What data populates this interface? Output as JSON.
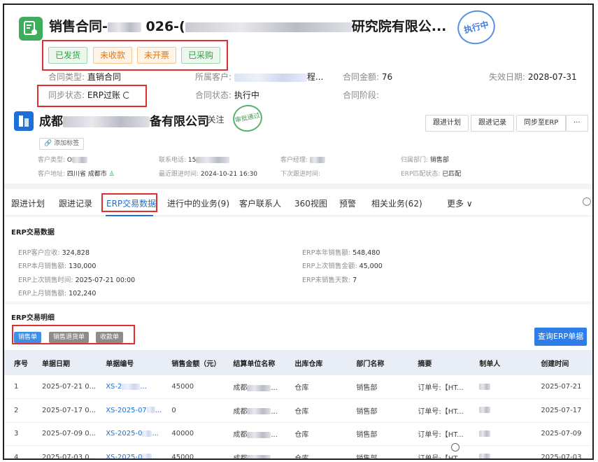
{
  "header": {
    "title_prefix": "销售合同-",
    "title_mid": "026-(",
    "title_suffix": "研究院有限公...",
    "stamp_text": "执行中",
    "tags": [
      "已发货",
      "未收款",
      "未开票",
      "已采购"
    ],
    "fields": {
      "contract_type_label": "合同类型:",
      "contract_type_value": "直销合同",
      "customer_label": "所属客户:",
      "customer_value": "程...",
      "amount_label": "合同金额:",
      "amount_value": "76",
      "expire_label": "失效日期:",
      "expire_value": "2028-07-31",
      "sync_label": "同步状态:",
      "sync_value": "ERP过账",
      "status_label": "合同状态:",
      "status_value": "执行中",
      "stage_label": "合同阶段:",
      "stage_value": ""
    }
  },
  "customer": {
    "name_prefix": "成都",
    "name_suffix": "备有限公司",
    "follow_label": "关注",
    "seal_text": "审批通过",
    "buttons": [
      "跟进计划",
      "跟进记录",
      "同步至ERP",
      "···"
    ],
    "add_tag": "添加标签",
    "info": {
      "type_label": "客户类型:",
      "type_value": "O",
      "phone_label": "联系电话:",
      "phone_value": "15",
      "manager_label": "客户经理:",
      "manager_value": "",
      "dept_label": "归属部门:",
      "dept_value": "销售部",
      "address_label": "客户地址:",
      "address_value": "四川省 成都市",
      "last_follow_label": "最近跟进时间:",
      "last_follow_value": "2024-10-21 16:30",
      "next_follow_label": "下次跟进时间:",
      "next_follow_value": "",
      "erp_match_label": "ERP匹配状态:",
      "erp_match_value": "已匹配"
    }
  },
  "tabs": [
    {
      "label": "跟进计划"
    },
    {
      "label": "跟进记录"
    },
    {
      "label": "ERP交易数据"
    },
    {
      "label": "进行中的业务(9)"
    },
    {
      "label": "客户联系人"
    },
    {
      "label": "360视图"
    },
    {
      "label": "预警"
    },
    {
      "label": "相关业务(62)"
    },
    {
      "label": "更多"
    }
  ],
  "erp_data": {
    "title": "ERP交易数据",
    "receivable_label": "ERP客户应收:",
    "receivable_value": "324,828",
    "year_sales_label": "ERP本年销售额:",
    "year_sales_value": "548,480",
    "month_sales_label": "ERP本月销售额:",
    "month_sales_value": "130,000",
    "last_amount_label": "ERP上次销售金额:",
    "last_amount_value": "45,000",
    "last_time_label": "ERP上次销售时间:",
    "last_time_value": "2025-07-21 00:00",
    "days_label": "ERP未销售天数:",
    "days_value": "7",
    "last_month_label": "ERP上月销售额:",
    "last_month_value": "102,240"
  },
  "erp_detail": {
    "title": "ERP交易明细",
    "pills": [
      "销售单",
      "销售退货单",
      "收款单"
    ],
    "query_button": "查询ERP单据",
    "columns": [
      "序号",
      "单据日期",
      "单据编号",
      "销售金额（元）",
      "结算单位名称",
      "出库仓库",
      "部门名称",
      "摘要",
      "制单人",
      "创建时间"
    ],
    "rows": [
      [
        "1",
        "2025-07-21 0...",
        "XS-2",
        "45000",
        "成都",
        "仓库",
        "销售部",
        "订单号:【HT...",
        "",
        "2025-07-21"
      ],
      [
        "2",
        "2025-07-17 0...",
        "XS-2025-07",
        "0",
        "成都",
        "仓库",
        "销售部",
        "订单号:【HT...",
        "",
        "2025-07-17"
      ],
      [
        "3",
        "2025-07-09 0...",
        "XS-2025-0",
        "40000",
        "成都",
        "仓库",
        "销售部",
        "订单号:【HT...",
        "",
        "2025-07-09"
      ],
      [
        "4",
        "2025-07-03 0...",
        "XS-2025-0",
        "45000",
        "成都",
        "仓库",
        "销售部",
        "订单号:【HT...",
        "",
        "2025-07-03"
      ]
    ]
  }
}
